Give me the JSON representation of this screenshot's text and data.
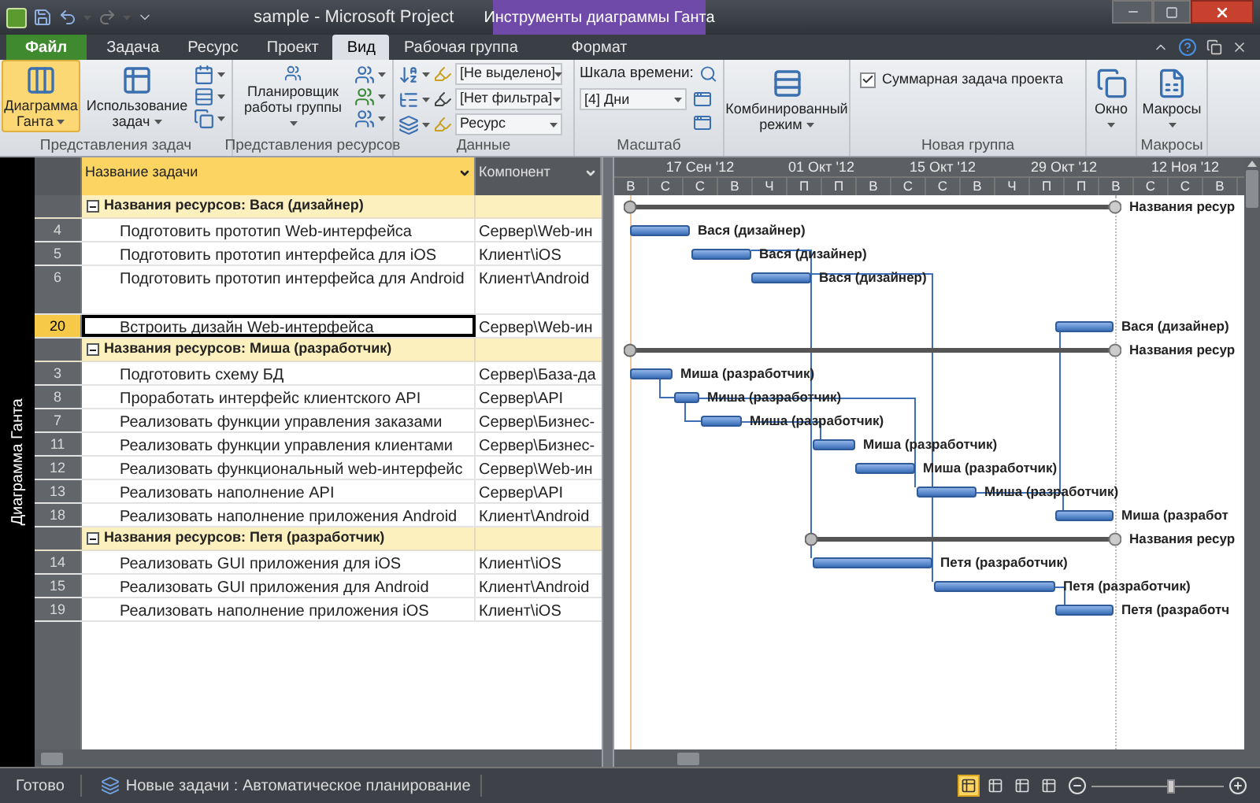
{
  "title_bar": {
    "title": "sample - Microsoft Project",
    "context_tab": "Инструменты диаграммы Ганта"
  },
  "tabs": [
    {
      "label": "Файл",
      "kind": "file",
      "selected": false
    },
    {
      "label": "Задача",
      "kind": "tab",
      "selected": false
    },
    {
      "label": "Ресурс",
      "kind": "tab",
      "selected": false
    },
    {
      "label": "Проект",
      "kind": "tab",
      "selected": false
    },
    {
      "label": "Вид",
      "kind": "tab",
      "selected": true
    },
    {
      "label": "Рабочая группа",
      "kind": "tab",
      "selected": false
    },
    {
      "label": "Формат",
      "kind": "context",
      "selected": false
    }
  ],
  "ribbon_groups": [
    {
      "kind": "task_views",
      "label": "Представления задач",
      "buttons": [
        {
          "label": "Диаграмма Ганта",
          "selected": true
        },
        {
          "label": "Использование задач",
          "selected": false
        }
      ]
    },
    {
      "kind": "resource_views",
      "label": "Представления ресурсов",
      "buttons": [
        {
          "label": "Планировщик работы группы"
        }
      ]
    },
    {
      "kind": "data",
      "label": "Данные",
      "dropdowns": [
        {
          "value": "[Не выделено]"
        },
        {
          "value": "[Нет фильтра]"
        },
        {
          "value": "Ресурс"
        }
      ]
    },
    {
      "kind": "zoom",
      "label": "Масштаб",
      "field_label": "Шкала времени:",
      "dropdowns": [
        {
          "value": "[4] Дни"
        }
      ]
    },
    {
      "kind": "split",
      "buttons": [
        {
          "label": "Комбинированный режим"
        }
      ]
    },
    {
      "kind": "new_group",
      "label": "Новая группа",
      "checkbox": {
        "label": "Суммарная задача проекта",
        "checked": true
      }
    },
    {
      "kind": "window",
      "buttons": [
        {
          "label": "Окно"
        }
      ]
    },
    {
      "kind": "macros",
      "label": "Макросы",
      "buttons": [
        {
          "label": "Макросы"
        }
      ]
    }
  ],
  "side_label": "Диаграмма Ганта",
  "table": {
    "columns": [
      {
        "label": "Название задачи",
        "selected": true
      },
      {
        "label": "Компонент",
        "selected": false
      }
    ],
    "rows": [
      {
        "kind": "group",
        "expanded": true,
        "name": "Названия ресурсов: Вася (дизайнер)",
        "bar_label": "Названия ресур",
        "selected": false
      },
      {
        "kind": "task",
        "id": "4",
        "name": "Подготовить прототип Web-интерфейса",
        "component": "Сервер\\Web-ин",
        "bar_label": "Вася (дизайнер)",
        "selected": false
      },
      {
        "kind": "task",
        "id": "5",
        "name": "Подготовить прототип интерфейса для iOS",
        "component": "Клиент\\iOS",
        "bar_label": "Вася (дизайнер)",
        "selected": false
      },
      {
        "kind": "task",
        "id": "6",
        "name": "Подготовить прототип интерфейса для Android",
        "component": "Клиент\\Android",
        "bar_label": "Вася (дизайнер)",
        "selected": false
      },
      {
        "kind": "task",
        "id": "20",
        "name": "Встроить дизайн Web-интерфейса",
        "component": "Сервер\\Web-ин",
        "bar_label": "Вася (дизайнер)",
        "selected": true
      },
      {
        "kind": "group",
        "expanded": true,
        "name": "Названия ресурсов: Миша (разработчик)",
        "bar_label": "Названия ресур",
        "selected": false
      },
      {
        "kind": "task",
        "id": "3",
        "name": "Подготовить схему БД",
        "component": "Сервер\\База-да",
        "bar_label": "Миша (разработчик)",
        "selected": false
      },
      {
        "kind": "task",
        "id": "8",
        "name": "Проработать интерфейс клиентского API",
        "component": "Сервер\\API",
        "bar_label": "Миша (разработчик)",
        "selected": false
      },
      {
        "kind": "task",
        "id": "7",
        "name": "Реализовать функции управления заказами",
        "component": "Сервер\\Бизнес-",
        "bar_label": "Миша (разработчик)",
        "selected": false
      },
      {
        "kind": "task",
        "id": "11",
        "name": "Реализовать функции управления клиентами",
        "component": "Сервер\\Бизнес-",
        "bar_label": "Миша (разработчик)",
        "selected": false
      },
      {
        "kind": "task",
        "id": "12",
        "name": "Реализовать функциональный web-интерфейс",
        "component": "Сервер\\Web-ин",
        "bar_label": "Миша (разработчик)",
        "selected": false
      },
      {
        "kind": "task",
        "id": "13",
        "name": "Реализовать наполнение API",
        "component": "Сервер\\API",
        "bar_label": "Миша (разработчик)",
        "selected": false
      },
      {
        "kind": "task",
        "id": "18",
        "name": "Реализовать наполнение приложения Android",
        "component": "Клиент\\Android",
        "bar_label": "Миша (разработ",
        "selected": false
      },
      {
        "kind": "group",
        "expanded": true,
        "name": "Названия ресурсов: Петя (разработчик)",
        "bar_label": "Названия ресур",
        "selected": false
      },
      {
        "kind": "task",
        "id": "14",
        "name": "Реализовать GUI приложения для iOS",
        "component": "Клиент\\iOS",
        "bar_label": "Петя (разработчик)",
        "selected": false
      },
      {
        "kind": "task",
        "id": "15",
        "name": "Реализовать GUI приложения для Android",
        "component": "Клиент\\Android",
        "bar_label": "Петя (разработчик)",
        "selected": false
      },
      {
        "kind": "task",
        "id": "19",
        "name": "Реализовать наполнение приложения iOS",
        "component": "Клиент\\iOS",
        "bar_label": "Петя (разработч",
        "selected": false
      }
    ]
  },
  "timescale": {
    "major": [
      "17 Сен '12",
      "01 Окт '12",
      "15 Окт '12",
      "29 Окт '12",
      "12 Ноя '12"
    ],
    "minor": [
      "В",
      "С",
      "С",
      "В",
      "Ч",
      "П",
      "П",
      "В",
      "С",
      "С",
      "В",
      "Ч",
      "П",
      "П",
      "В",
      "С",
      "С",
      "В"
    ]
  },
  "status_bar": {
    "status": "Готово",
    "new_tasks": "Новые задачи : Автоматическое планирование",
    "views": [
      {
        "selected": true
      },
      {
        "selected": false
      },
      {
        "selected": false
      },
      {
        "selected": false
      }
    ],
    "zoom": {
      "level": 0.6
    }
  }
}
